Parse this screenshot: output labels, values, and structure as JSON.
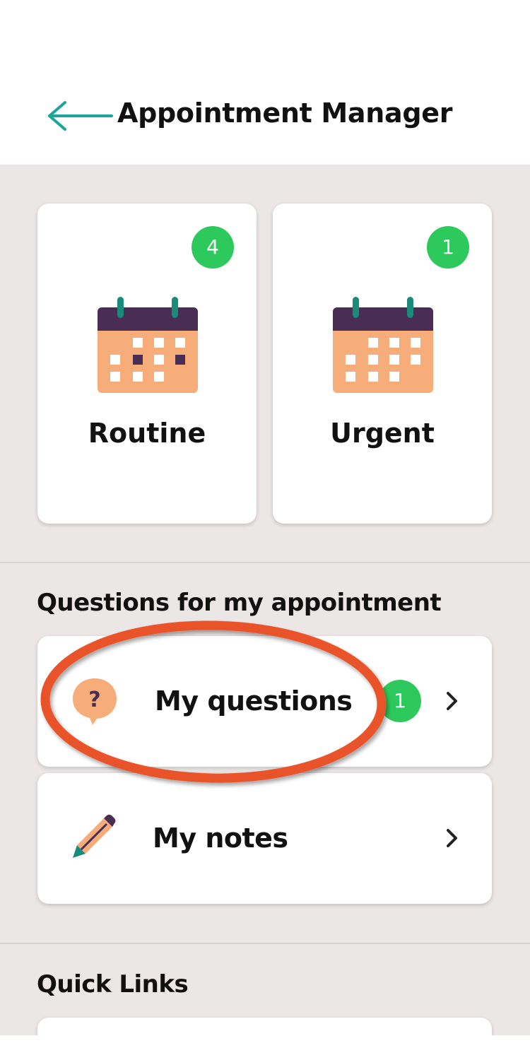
{
  "header": {
    "title": "Appointment Manager",
    "back_icon": "arrow-left-icon",
    "accent_color": "#1aa59a"
  },
  "appointments": [
    {
      "label": "Routine",
      "count": "4",
      "icon": "calendar-icon"
    },
    {
      "label": "Urgent",
      "count": "1",
      "icon": "calendar-icon"
    }
  ],
  "questions_section": {
    "heading": "Questions for my appointment",
    "items": [
      {
        "label": "My questions",
        "count": "1",
        "icon": "question-bubble-icon"
      },
      {
        "label": "My notes",
        "icon": "pencil-icon"
      }
    ]
  },
  "quick_links": {
    "heading": "Quick Links"
  },
  "colors": {
    "badge": "#2ec95c",
    "background": "#ece7e7",
    "highlight": "#e8532a",
    "calendar_body": "#f7ad7a",
    "calendar_top": "#4a2d52",
    "calendar_ring": "#1a8a7a"
  }
}
